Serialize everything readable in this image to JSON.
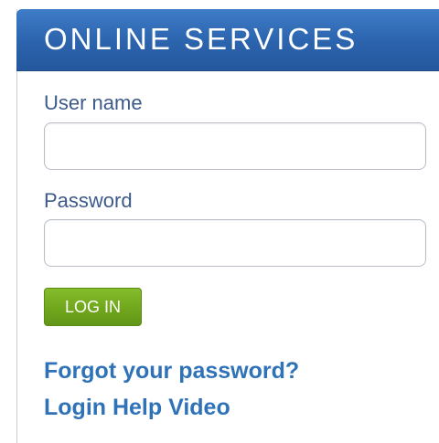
{
  "header": {
    "title": "ONLINE SERVICES"
  },
  "form": {
    "username_label": "User name",
    "username_value": "",
    "password_label": "Password",
    "password_value": "",
    "login_button_label": "LOG IN"
  },
  "links": {
    "forgot_password": "Forgot your password?",
    "help_video": "Login Help Video"
  },
  "colors": {
    "header_blue": "#2b63ad",
    "label_blue": "#3c5a8a",
    "button_green": "#6fa51b",
    "link_blue": "#2f72b7"
  }
}
